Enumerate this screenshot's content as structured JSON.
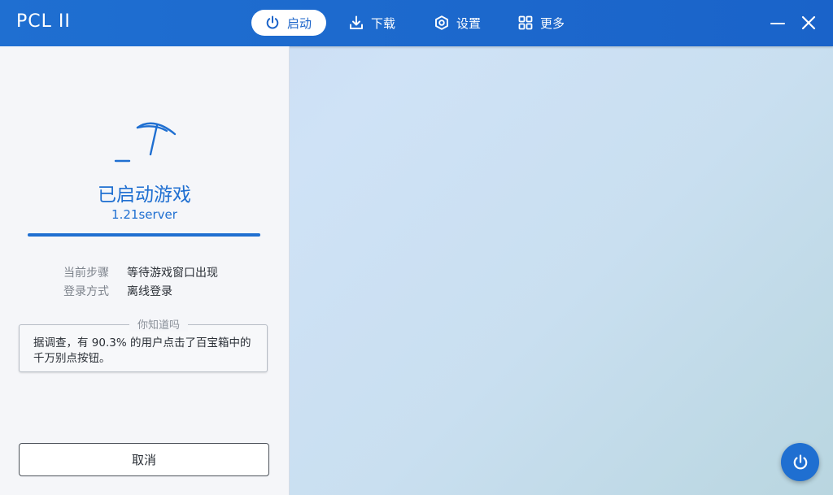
{
  "app": {
    "title": "PCL II"
  },
  "nav": {
    "items": [
      {
        "label": "启动",
        "icon": "power-icon",
        "active": true
      },
      {
        "label": "下载",
        "icon": "download-icon",
        "active": false
      },
      {
        "label": "设置",
        "icon": "settings-icon",
        "active": false
      },
      {
        "label": "更多",
        "icon": "grid-icon",
        "active": false
      }
    ]
  },
  "window_controls": {
    "minimize_icon": "minimize-icon",
    "close_icon": "close-icon"
  },
  "launch_panel": {
    "icon": "pickaxe-icon",
    "status_title": "已启动游戏",
    "version": "1.21server",
    "progress_fraction": 1.0,
    "info": [
      {
        "key": "当前步骤",
        "value": "等待游戏窗口出现"
      },
      {
        "key": "登录方式",
        "value": "离线登录"
      }
    ],
    "tip": {
      "legend": "你知道吗",
      "text": "据调查，有 90.3% 的用户点击了百宝箱中的千万别点按钮。"
    },
    "cancel_label": "取消"
  },
  "fab": {
    "icon": "power-icon"
  },
  "colors": {
    "accent": "#1f6fd1",
    "titlebar": "#1a63c9"
  }
}
